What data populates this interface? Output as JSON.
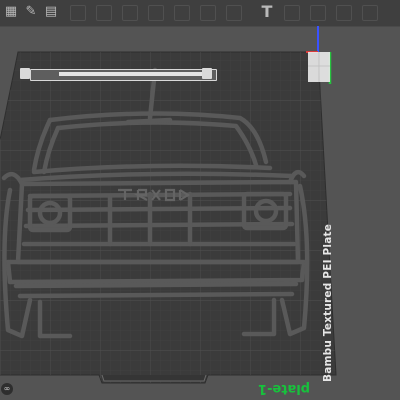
{
  "toolbar": {
    "tools": [
      {
        "icon": "view-grid-icon",
        "glyph": "▦"
      },
      {
        "icon": "edit-icon",
        "glyph": "✎"
      },
      {
        "icon": "layers-icon",
        "glyph": "▤"
      },
      {
        "icon": "text-tool-icon",
        "glyph": "T"
      }
    ]
  },
  "plate": {
    "type_label": "Bambu Textured PEI Plate",
    "name_label": "plate-1",
    "name_color": "#17c23c"
  },
  "colors": {
    "background": "#545454",
    "plate": "#3d3d3d",
    "grid": "#4d4d4d",
    "model": "#4e4e4e",
    "axis_x": "#d93a3a",
    "axis_y": "#27c43f",
    "axis_z": "#3a52ff"
  },
  "badge": {
    "glyph": "∞"
  }
}
